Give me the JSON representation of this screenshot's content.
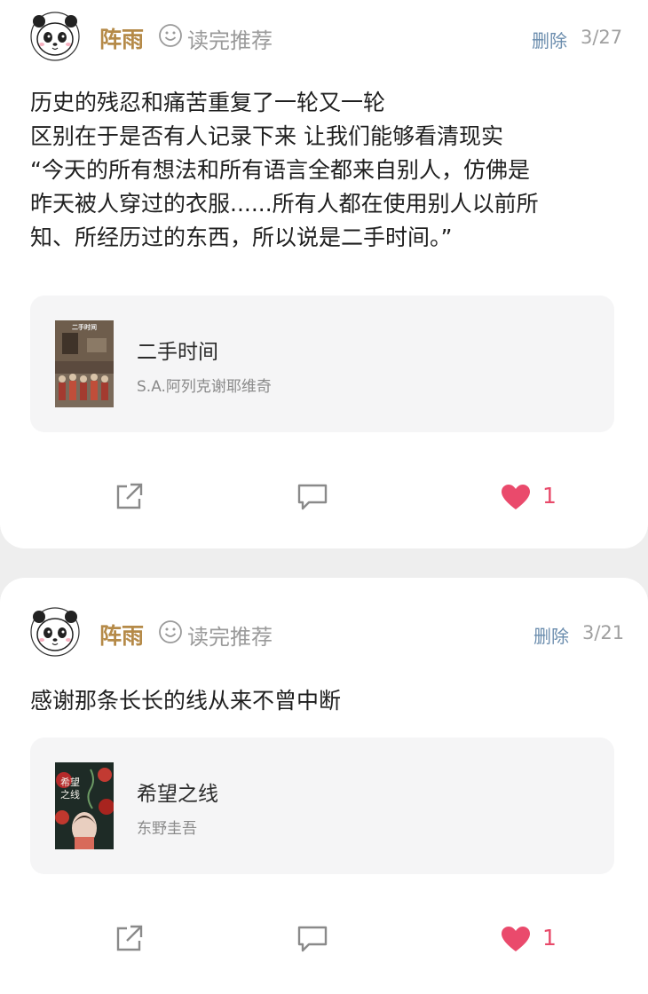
{
  "posts": [
    {
      "username": "阵雨",
      "recommend_label": "读完推荐",
      "delete_label": "删除",
      "date": "3/27",
      "content": "历史的残忍和痛苦重复了一轮又一轮\n区别在于是否有人记录下来 让我们能够看清现实\n“今天的所有想法和所有语言全都来自别人，仿佛是\n昨天被人穿过的衣服......所有人都在使用别人以前所\n知、所经历过的东西，所以说是二手时间。”",
      "book": {
        "title": "二手时间",
        "author": "S.A.阿列克谢耶维奇",
        "cover_text": "二手时间"
      },
      "likes": "1"
    },
    {
      "username": "阵雨",
      "recommend_label": "读完推荐",
      "delete_label": "删除",
      "date": "3/21",
      "content": "感谢那条长长的线从来不曾中断",
      "book": {
        "title": "希望之线",
        "author": "东野圭吾",
        "cover_text": "希望之线"
      },
      "likes": "1"
    }
  ],
  "icons": {
    "avatar": "panda-avatar-icon",
    "recommend": "smiley-icon",
    "share": "share-icon",
    "comment": "comment-icon",
    "like": "heart-icon"
  },
  "colors": {
    "username": "#b58a48",
    "delete": "#6a8cad",
    "like": "#e84a6a",
    "card_bg": "#ffffff",
    "page_bg": "#eeeeee",
    "book_card_bg": "#f5f5f6"
  }
}
